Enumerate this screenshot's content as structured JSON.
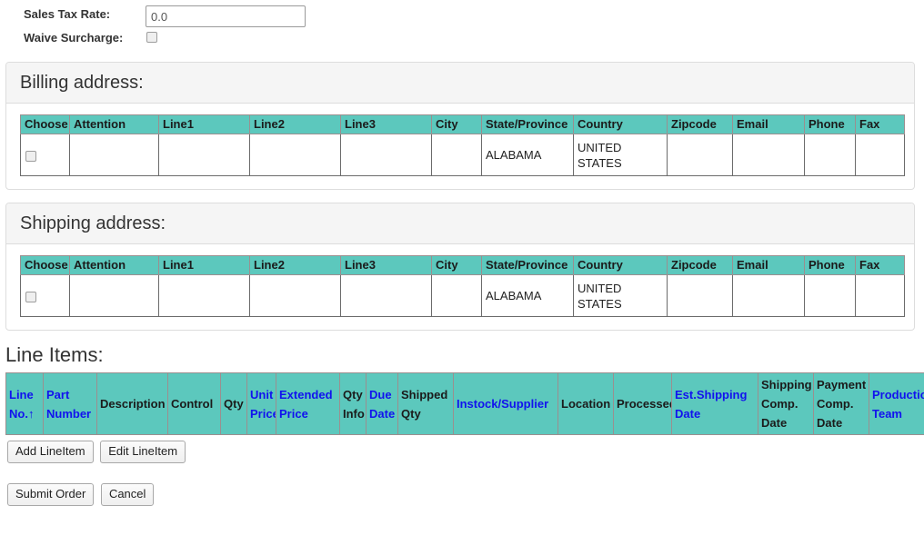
{
  "form": {
    "fields": [
      {
        "label": "Sales Tax Rate:",
        "type": "text",
        "value": "0.0"
      },
      {
        "label": "Waive Surcharge:",
        "type": "checkbox",
        "checked": false
      }
    ]
  },
  "billing": {
    "title": "Billing address:",
    "columns": [
      "Choose",
      "Attention",
      "Line1",
      "Line2",
      "Line3",
      "City",
      "State/Province",
      "Country",
      "Zipcode",
      "Email",
      "Phone",
      "Fax"
    ],
    "rows": [
      {
        "choose": false,
        "attention": "",
        "line1": "",
        "line2": "",
        "line3": "",
        "city": "",
        "state": "ALABAMA",
        "country": "UNITED STATES",
        "zipcode": "",
        "email": "",
        "phone": "",
        "fax": ""
      }
    ]
  },
  "shipping": {
    "title": "Shipping address:",
    "columns": [
      "Choose",
      "Attention",
      "Line1",
      "Line2",
      "Line3",
      "City",
      "State/Province",
      "Country",
      "Zipcode",
      "Email",
      "Phone",
      "Fax"
    ],
    "rows": [
      {
        "choose": false,
        "attention": "",
        "line1": "",
        "line2": "",
        "line3": "",
        "city": "",
        "state": "ALABAMA",
        "country": "UNITED STATES",
        "zipcode": "",
        "email": "",
        "phone": "",
        "fax": ""
      }
    ]
  },
  "line_items": {
    "title": "Line Items:",
    "sort_indicator": "↑",
    "columns": [
      {
        "label": "Line No.",
        "sortable": true,
        "sorted": "asc"
      },
      {
        "label": "Part Number",
        "sortable": true
      },
      {
        "label": "Description",
        "sortable": false
      },
      {
        "label": "Control",
        "sortable": false
      },
      {
        "label": "Qty",
        "sortable": false
      },
      {
        "label": "Unit Price",
        "sortable": true
      },
      {
        "label": "Extended Price",
        "sortable": true
      },
      {
        "label": "Qty Info",
        "sortable": false
      },
      {
        "label": "Due Date",
        "sortable": true
      },
      {
        "label": "Shipped Qty",
        "sortable": false
      },
      {
        "label": "Instock/Supplier",
        "sortable": true
      },
      {
        "label": "Location",
        "sortable": false
      },
      {
        "label": "Processed",
        "sortable": false
      },
      {
        "label": "Est.Shipping Date",
        "sortable": true
      },
      {
        "label": "Shipping Comp. Date",
        "sortable": false
      },
      {
        "label": "Payment Comp. Date",
        "sortable": false
      },
      {
        "label": "Production Team",
        "sortable": true
      }
    ],
    "rows": []
  },
  "buttons": {
    "add_lineitem": "Add LineItem",
    "edit_lineitem": "Edit LineItem",
    "submit_order": "Submit Order",
    "cancel": "Cancel"
  },
  "colors": {
    "table_header": "#5cc8bd",
    "link": "#1212ee",
    "panel_heading_bg": "#f5f5f5",
    "panel_border": "#dddddd"
  }
}
